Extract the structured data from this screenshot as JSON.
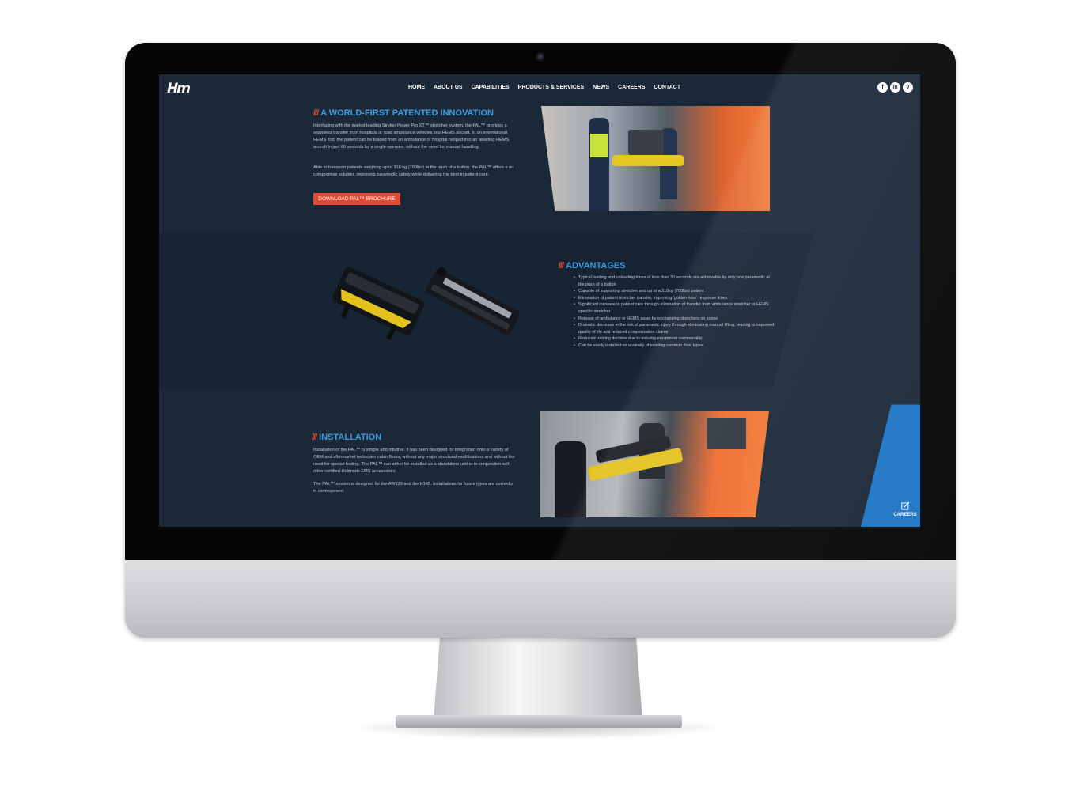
{
  "site": {
    "logo": "Hm",
    "nav": [
      "HOME",
      "ABOUT US",
      "CAPABILITIES",
      "PRODUCTS & SERVICES",
      "NEWS",
      "CAREERS",
      "CONTACT"
    ],
    "social": [
      {
        "icon": "facebook-icon",
        "glyph": "f"
      },
      {
        "icon": "linkedin-icon",
        "glyph": "in"
      },
      {
        "icon": "vimeo-icon",
        "glyph": "v"
      }
    ]
  },
  "section1": {
    "slash": "///",
    "title": "A WORLD-FIRST PATENTED INNOVATION",
    "p1": "Interfacing with the market leading Stryker Power Pro XT™ stretcher system, the PAL™ provides a seamless transfer from hospitals or road ambulance vehicles into HEMS aircraft. In an international HEMS first, the patient can be loaded from an ambulance or hospital helipad into an awaiting HEMS aircraft in just 60 seconds by a single operator, without the need for manual handling.",
    "p2": "Able to transport patients weighing up to 318 kg (700lbs) at the push of a button, the PAL™ offers a no compromise solution, improving paramedic safety while delivering the best in patient care.",
    "button": "DOWNLOAD PAL™ BROCHURE"
  },
  "section2": {
    "slash": "///",
    "title": "ADVANTAGES",
    "items": [
      "Typical loading and unloading times of less than 30 seconds are achievable by only one paramedic at the push of a button",
      "Capable of supporting stretcher and up to a 318kg (700lbs) patient",
      "Elimination of patient stretcher transfer, improving 'golden hour' response times",
      "Significant increase in patient care through elimination of transfer from ambulance stretcher to HEMS specific stretcher",
      "Release of ambulance or HEMS asset by exchanging stretchers on scene",
      "Dramatic decrease in the risk of paramedic injury through eliminating manual lifting, leading to improved quality of life and reduced compensation claims",
      "Reduced training doctrine due to industry equipment commonality",
      "Can be easily installed on a variety of existing common floor types"
    ]
  },
  "section3": {
    "slash": "///",
    "title": "INSTALLATION",
    "p1": "Installation of the PAL™ is simple and intuitive. It has been designed for integration onto a variety of OEM and aftermarket helicopter cabin floors, without any major structural modifications and without the need for special tooling. The PAL™ can either be installed as a standalone unit or in conjunction with other certified Helimods EMS accessories.",
    "p2": "The PAL™ system is designed for the AW139 and the H145. Installations for future types are currently in development."
  },
  "careers_tab": {
    "label": "CAREERS",
    "icon": "edit-icon"
  },
  "colors": {
    "bg": "#1b2838",
    "accent_blue": "#3d9be0",
    "accent_red": "#e14b36",
    "band_blue": "#1c74c4"
  }
}
